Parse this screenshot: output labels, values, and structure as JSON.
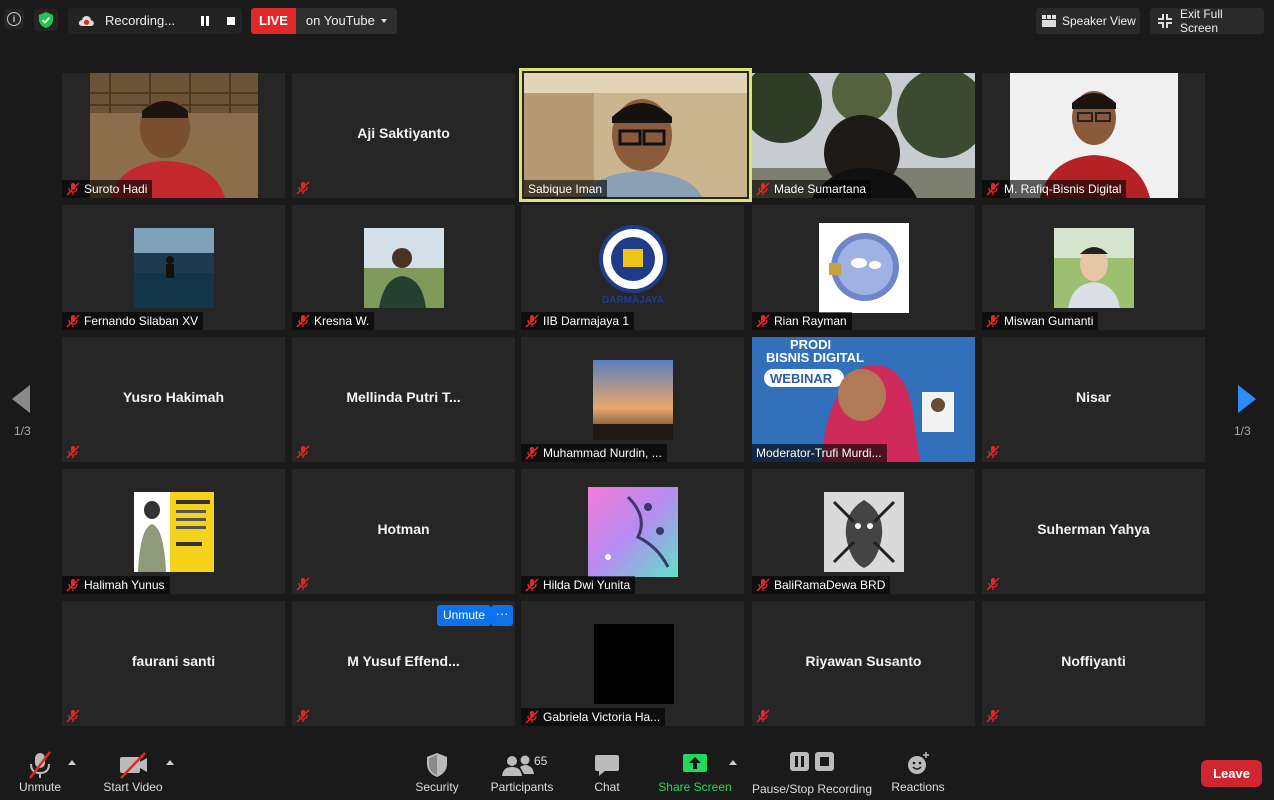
{
  "topbar": {
    "recording_label": "Recording...",
    "live_badge": "LIVE",
    "live_target": "on YouTube",
    "speaker_view": "Speaker View",
    "exit_full_screen": "Exit Full Screen"
  },
  "pager": {
    "left": "1/3",
    "right": "1/3"
  },
  "tiles": [
    {
      "name": "Suroto Hadi",
      "display": "video"
    },
    {
      "name": "Aji Saktiyanto",
      "display": "name"
    },
    {
      "name": "Sabique Iman",
      "display": "video",
      "active": true
    },
    {
      "name": "Made Sumartana",
      "display": "video"
    },
    {
      "name": "M. Rafiq-Bisnis Digital",
      "display": "video"
    },
    {
      "name": "Fernando Silaban XV",
      "display": "photo"
    },
    {
      "name": "Kresna W.",
      "display": "photo"
    },
    {
      "name": "IIB Darmajaya 1",
      "display": "photo"
    },
    {
      "name": "Rian Rayman",
      "display": "photo"
    },
    {
      "name": "Miswan Gumanti",
      "display": "photo"
    },
    {
      "name": "Yusro Hakimah",
      "display": "name"
    },
    {
      "name": "Mellinda Putri T...",
      "display": "name"
    },
    {
      "name": "Muhammad Nurdin, ...",
      "display": "photo"
    },
    {
      "name": "Moderator-Trufi Murdi...",
      "display": "video"
    },
    {
      "name": "Nisar",
      "display": "name"
    },
    {
      "name": "Halimah Yunus",
      "display": "photo"
    },
    {
      "name": "Hotman",
      "display": "name"
    },
    {
      "name": "Hilda Dwi Yunita",
      "display": "photo"
    },
    {
      "name": "BaliRamaDewa BRD",
      "display": "photo"
    },
    {
      "name": "Suherman Yahya",
      "display": "name"
    },
    {
      "name": "faurani santi",
      "display": "name"
    },
    {
      "name": "M Yusuf Effend...",
      "display": "name"
    },
    {
      "name": "Gabriela Victoria Ha...",
      "display": "photo"
    },
    {
      "name": "Riyawan Susanto",
      "display": "name"
    },
    {
      "name": "Noffiyanti",
      "display": "name"
    }
  ],
  "tile_overlay": {
    "unmute": "Unmute",
    "more": "···"
  },
  "darmajaya_logo_text": "DARMAJAYA",
  "webinar_slide": {
    "line1": "PRODI",
    "line2": "BISNIS DIGITAL",
    "line3": "WEBINAR"
  },
  "bottombar": {
    "unmute": "Unmute",
    "start_video": "Start Video",
    "security": "Security",
    "participants": "Participants",
    "participants_count": "65",
    "chat": "Chat",
    "share_screen": "Share Screen",
    "pause_stop_recording": "Pause/Stop Recording",
    "reactions": "Reactions",
    "leave": "Leave"
  },
  "colors": {
    "background": "#1a1a1a",
    "tile": "#262626",
    "active_border": "#d9e66a",
    "live_red": "#e02828",
    "leave_red": "#d0262f",
    "accent_blue": "#0e72ed",
    "share_green": "#23d959",
    "muted_red": "#e02828"
  }
}
